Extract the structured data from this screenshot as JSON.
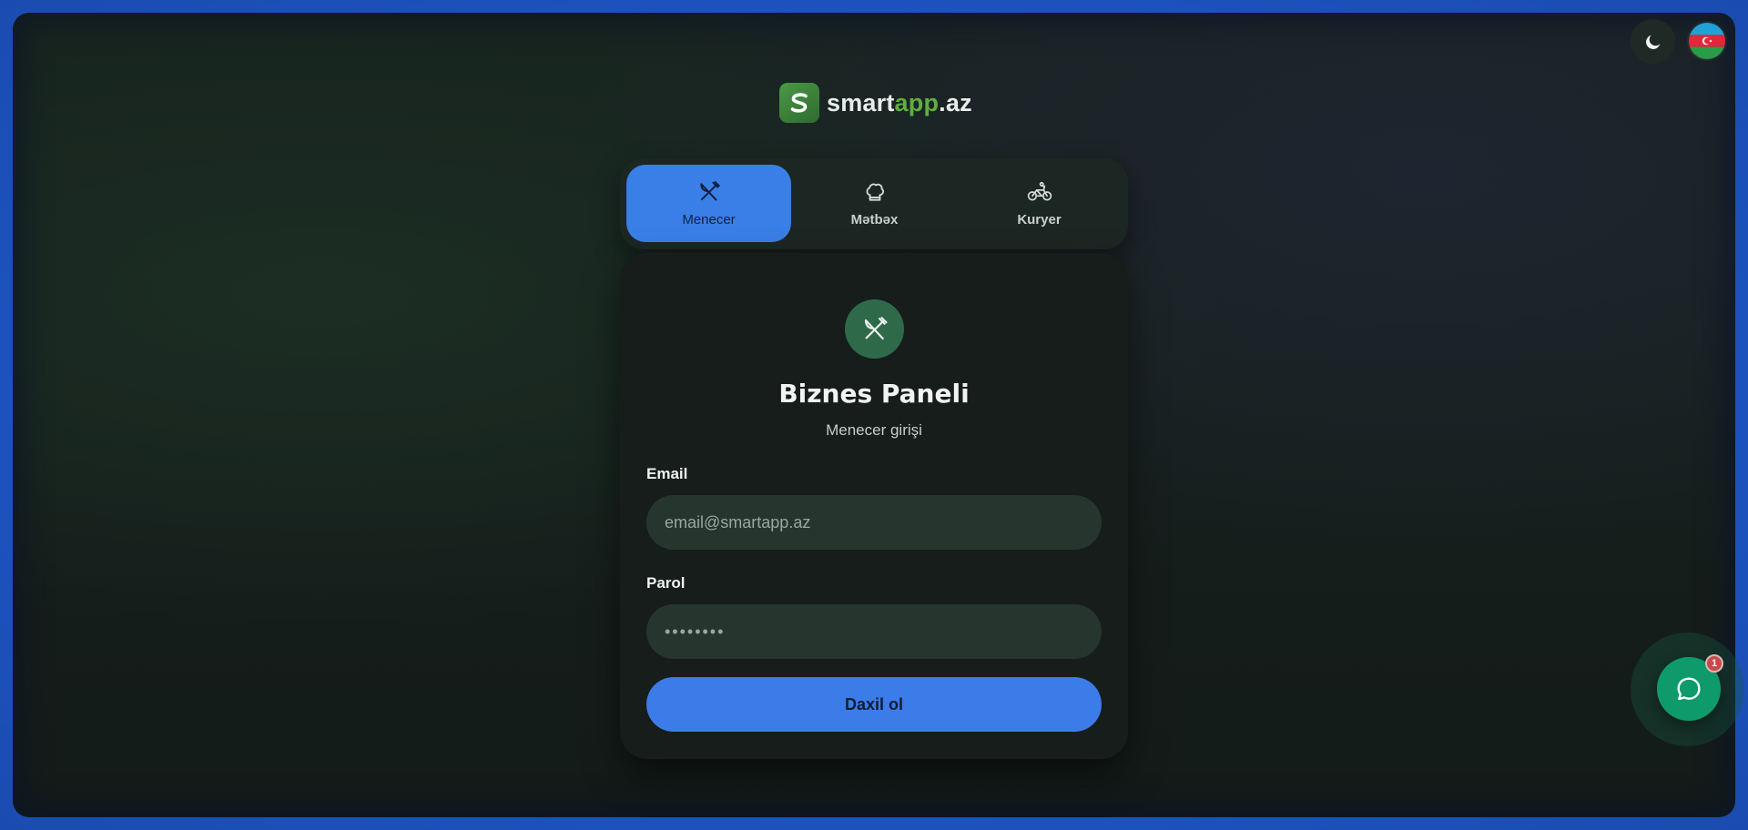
{
  "header": {
    "logo": {
      "part1": "smart",
      "accent": "app",
      "part2": ".az",
      "brand_color": "#5fae3f"
    },
    "theme_icon": "moon-icon",
    "language_flag": "azerbaijan-flag"
  },
  "tabs": [
    {
      "label": "Menecer",
      "icon": "fork-knife-icon",
      "active": true
    },
    {
      "label": "Mətbəx",
      "icon": "chef-hat-icon",
      "active": false
    },
    {
      "label": "Kuryer",
      "icon": "bicycle-icon",
      "active": false
    }
  ],
  "card": {
    "icon": "fork-knife-icon",
    "title": "Biznes Paneli",
    "subtitle": "Menecer girişi",
    "email": {
      "label": "Email",
      "placeholder": "email@smartapp.az",
      "value": ""
    },
    "password": {
      "label": "Parol",
      "placeholder": "••••••••",
      "value": ""
    },
    "submit_label": "Daxil ol"
  },
  "chat": {
    "icon": "chat-bubble-icon",
    "unread": "1"
  },
  "colors": {
    "accent": "#3a7ee8",
    "chat": "#0f9a6b",
    "badge_bg": "#2e6a4a"
  }
}
